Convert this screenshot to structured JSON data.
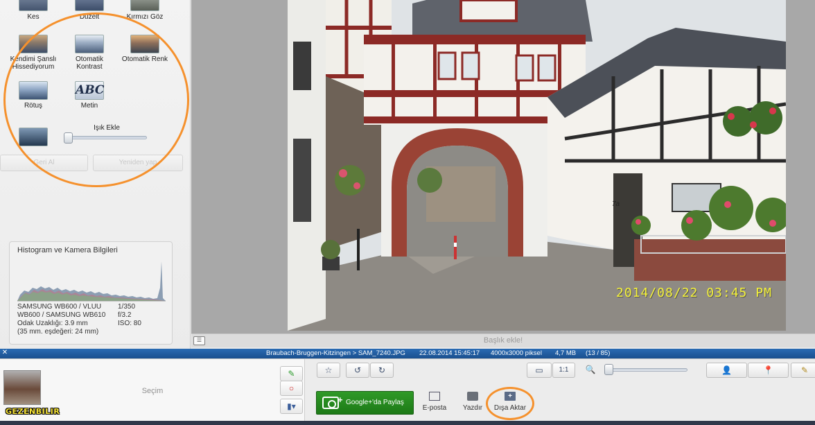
{
  "tools": {
    "crop": "Kes",
    "straighten": "Düzelt",
    "red_eye": "Kırmızı Göz",
    "feeling_lucky": "Kendimi Şanslı Hissediyorum",
    "auto_contrast": "Otomatik Kontrast",
    "auto_color": "Otomatik Renk",
    "retouch": "Rötuş",
    "text": "Metin",
    "text_thumb": "ABC",
    "fill_light": "Işık Ekle",
    "fill_light_level": 0
  },
  "history": {
    "undo": "Geri Al",
    "redo": "Yeniden yap"
  },
  "histogram": {
    "title": "Histogram ve Kamera Bilgileri",
    "camera_line1": "SAMSUNG WB600 / VLUU",
    "camera_line2": "WB600 / SAMSUNG WB610",
    "focal": "Odak Uzaklığı: 3.9 mm",
    "equiv": "(35 mm. eşdeğeri:  24 mm)",
    "shutter": "1/350",
    "aperture": "f/3.2",
    "iso": "ISO: 80"
  },
  "photo": {
    "date_stamp": "2014/08/22 03:45 PM",
    "house_number": "7a"
  },
  "caption": {
    "placeholder": "Başlık ekle!"
  },
  "info_bar": {
    "path": "Braubach-Bruggen-Kitzingen > SAM_7240.JPG",
    "datetime": "22.08.2014 15:45:17",
    "dimensions": "4000x3000 piksel",
    "size": "4,7 MB",
    "index": "(13 / 85)"
  },
  "tray": {
    "label": "Seçim",
    "logo": "GEZENBILIR"
  },
  "toolbar": {
    "actual_size": "1:1"
  },
  "actions": {
    "share": "Google+'da Paylaş",
    "email": "E-posta",
    "print": "Yazdır",
    "export": "Dışa Aktar"
  },
  "colors": {
    "annotation": "#f5912d",
    "share_green": "#2a8f22",
    "info_bar_blue": "#1f5a9e",
    "date_stamp": "#f5f23a"
  }
}
